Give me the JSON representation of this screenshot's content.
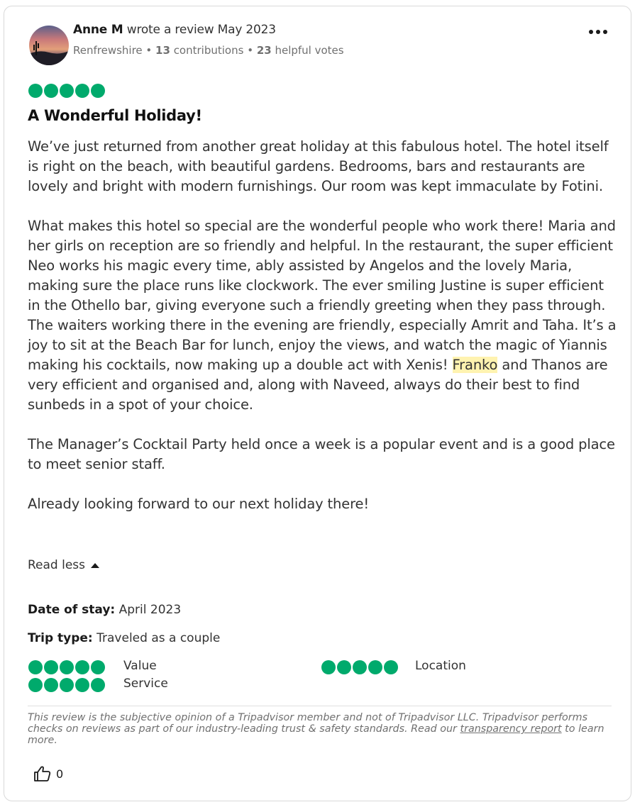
{
  "reviewer": {
    "name": "Anne M",
    "action": " wrote a review May 2023",
    "location": "Renfrewshire",
    "contributions_count": "13",
    "contributions_label": " contributions",
    "helpful_count": "23",
    "helpful_label": " helpful votes",
    "separator": " • "
  },
  "rating": {
    "overall": 5,
    "max": 5,
    "color": "#00aa6c"
  },
  "review": {
    "title": "A Wonderful Holiday!",
    "paragraph1": "We’ve just returned from another great holiday at this fabulous hotel. The hotel itself is right on the beach, with beautiful gardens. Bedrooms, bars and restaurants are lovely and bright with modern furnishings. Our room was kept immaculate by Fotini.",
    "paragraph2_a": "What makes this hotel so special are the wonderful people who work there! Maria and her girls on reception are so friendly and helpful. In the restaurant, the super efficient Neo works his magic every time, ably assisted by Angelos and the lovely Maria, making sure the place runs like clockwork. The ever smiling Justine is super efficient in the Othello bar, giving everyone such a friendly greeting when they pass through. The waiters working there in the evening are friendly, especially Amrit and Taha. It’s a joy to sit at the Beach Bar for lunch, enjoy the views, and watch the magic of Yiannis making his cocktails, now making up a double act with Xenis! ",
    "paragraph2_highlight": "Franko",
    "paragraph2_b": " and Thanos are very efficient and organised and, along with Naveed, always do their best to find sunbeds in a spot of your choice.",
    "paragraph3": "The Manager’s Cocktail Party held once a week is a popular event and is a good place to meet senior staff.",
    "paragraph4": "Already looking forward to our next holiday there!",
    "read_less_label": "Read less",
    "highlight_color": "#fff3b0"
  },
  "details": {
    "date_label": "Date of stay:",
    "date_value": " April 2023",
    "trip_label": "Trip type:",
    "trip_value": " Traveled as a couple"
  },
  "subratings": [
    {
      "label": "Value",
      "rating": 5
    },
    {
      "label": "Location",
      "rating": 5
    },
    {
      "label": "Service",
      "rating": 5
    }
  ],
  "disclaimer": {
    "text_a": "This review is the subjective opinion of a Tripadvisor member and not of Tripadvisor LLC. Tripadvisor performs checks on reviews as part of our industry-leading trust & safety standards. Read our ",
    "link": "transparency report",
    "text_b": " to learn more."
  },
  "helpful": {
    "count": "0",
    "icon": "thumbs-up-icon"
  },
  "menu": {
    "icon": "more-options-icon"
  }
}
